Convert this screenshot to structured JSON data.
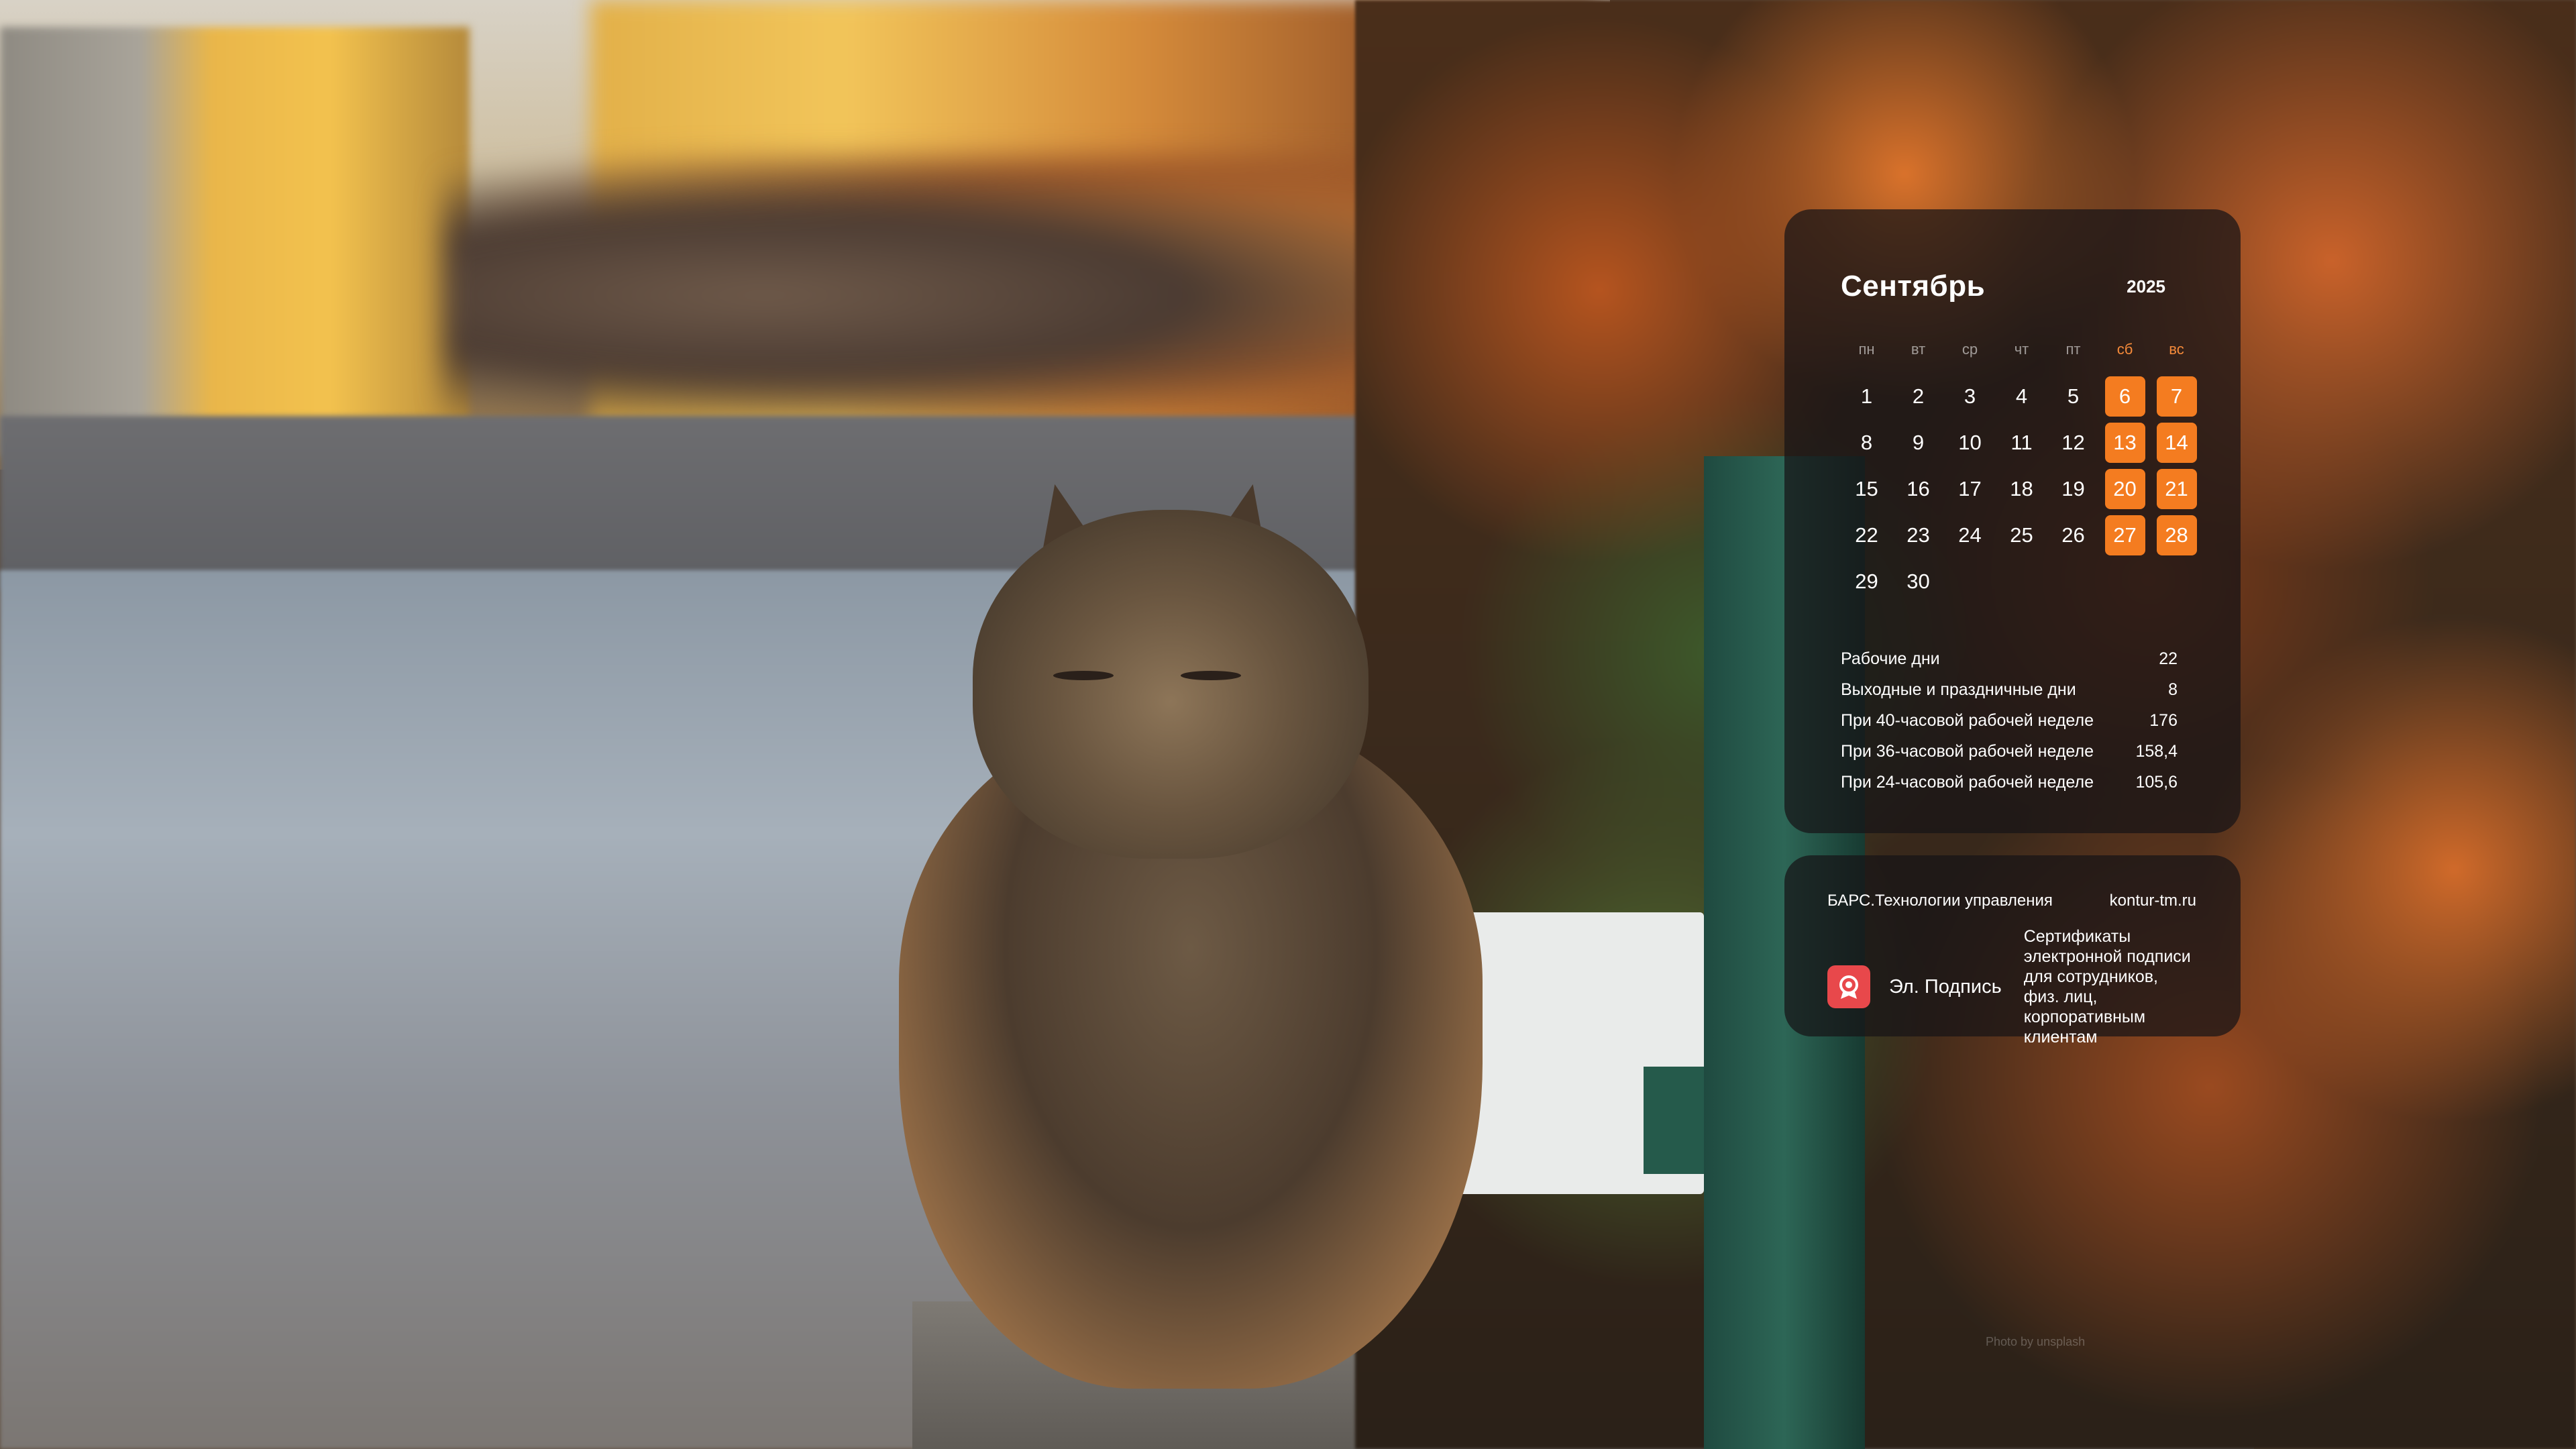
{
  "calendar": {
    "month": "Сентябрь",
    "year": "2025",
    "weekdays": [
      "пн",
      "вт",
      "ср",
      "чт",
      "пт",
      "сб",
      "вс"
    ],
    "weeks": [
      [
        "1",
        "2",
        "3",
        "4",
        "5",
        "6",
        "7"
      ],
      [
        "8",
        "9",
        "10",
        "11",
        "12",
        "13",
        "14"
      ],
      [
        "15",
        "16",
        "17",
        "18",
        "19",
        "20",
        "21"
      ],
      [
        "22",
        "23",
        "24",
        "25",
        "26",
        "27",
        "28"
      ],
      [
        "29",
        "30",
        "",
        "",
        "",
        "",
        ""
      ]
    ],
    "stats": [
      {
        "label": "Рабочие дни",
        "value": "22"
      },
      {
        "label": "Выходные и праздничные дни",
        "value": "8"
      },
      {
        "label": "При 40-часовой рабочей неделе",
        "value": "176"
      },
      {
        "label": "При 36-часовой рабочей неделе",
        "value": "158,4"
      },
      {
        "label": "При 24-часовой рабочей неделе",
        "value": "105,6"
      }
    ]
  },
  "ad": {
    "company": "БАРС.Технологии управления",
    "site": "kontur-tm.ru",
    "product": "Эл. Подпись",
    "description": "Сертификаты электронной подписи для сотрудников, физ. лиц, корпоративным клиентам",
    "logo_icon": "signature-seal-icon"
  },
  "credit": "Photo by unsplash",
  "colors": {
    "accent": "#f47c20",
    "panel": "rgba(22,20,22,0.72)",
    "logo": "#e8484b"
  }
}
